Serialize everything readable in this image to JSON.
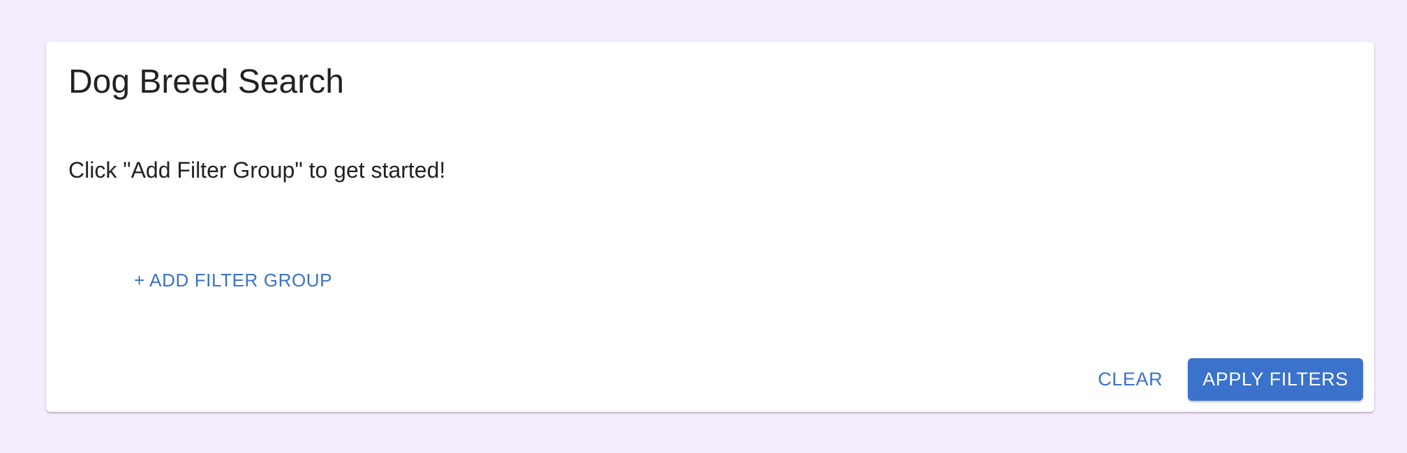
{
  "card": {
    "title": "Dog Breed Search",
    "hint": "Click \"Add Filter Group\" to get started!",
    "add_filter_group_label": "+ ADD FILTER GROUP"
  },
  "actions": {
    "clear_label": "CLEAR",
    "apply_label": "APPLY FILTERS"
  },
  "colors": {
    "page_background": "#f5ecfd",
    "card_background": "#ffffff",
    "accent": "#3a72cc",
    "text": "#222222"
  }
}
